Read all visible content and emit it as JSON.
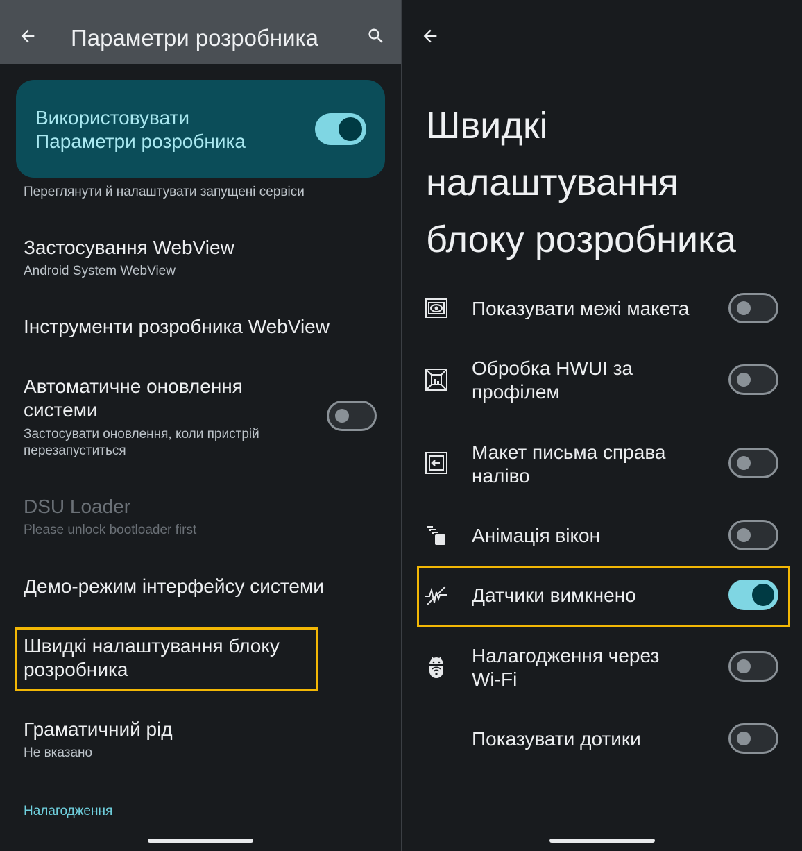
{
  "left": {
    "header": {
      "title": "Параметри розробника"
    },
    "main_toggle": {
      "label_line1": "Використовувати",
      "label_line2": "Параметри розробника",
      "state": "on"
    },
    "running_services_hint": "Переглянути й налаштувати запущені сервіси",
    "items": [
      {
        "title": "Застосування WebView",
        "subtitle": "Android System WebView"
      },
      {
        "title": "Інструменти розробника WebView"
      },
      {
        "title_line1": "Автоматичне оновлення",
        "title_line2": "системи",
        "subtitle_line1": "Застосувати оновлення, коли пристрій",
        "subtitle_line2": "перезапуститься",
        "toggle": "off"
      },
      {
        "title": "DSU Loader",
        "subtitle": "Please unlock bootloader first",
        "disabled": true
      },
      {
        "title": "Демо-режим інтерфейсу системи"
      },
      {
        "title_line1": "Швидкі налаштування блоку",
        "title_line2": "розробника",
        "highlighted": true
      },
      {
        "title": "Граматичний рід",
        "subtitle": "Не вказано"
      }
    ],
    "section_header": "Налагодження"
  },
  "right": {
    "title_line1": "Швидкі",
    "title_line2": "налаштування",
    "title_line3": "блоку розробника",
    "tiles": [
      {
        "label": "Показувати межі макета",
        "icon": "layout-bounds-icon",
        "toggle": "off"
      },
      {
        "label_line1": "Обробка HWUI за",
        "label_line2": "профілем",
        "icon": "hwui-profile-icon",
        "toggle": "off"
      },
      {
        "label_line1": "Макет письма справа",
        "label_line2": "наліво",
        "icon": "rtl-layout-icon",
        "toggle": "off"
      },
      {
        "label": "Анімація вікон",
        "icon": "window-animation-icon",
        "toggle": "off"
      },
      {
        "label": "Датчики вимкнено",
        "icon": "sensors-off-icon",
        "toggle": "on",
        "highlighted": true
      },
      {
        "label_line1": "Налагодження через",
        "label_line2": "Wi-Fi",
        "icon": "wifi-debug-icon",
        "toggle": "off"
      },
      {
        "label": "Показувати дотики",
        "toggle": "off"
      }
    ]
  },
  "colors": {
    "accent": "#7fd6e3",
    "highlight": "#f2b705",
    "card": "#0b4d59"
  }
}
